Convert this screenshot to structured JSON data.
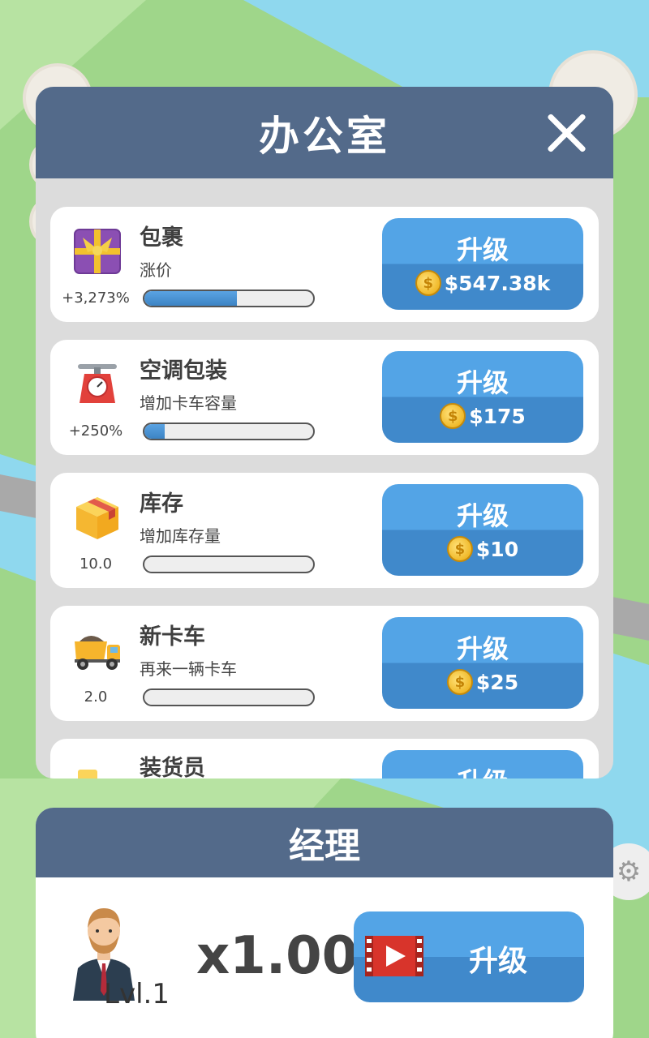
{
  "office": {
    "title": "办公室",
    "items": [
      {
        "name": "包裹",
        "desc": "涨价",
        "stat": "+3,273%",
        "progress": 0.55,
        "button_label": "升级",
        "price": "$547.38k",
        "icon": "gift-box-icon"
      },
      {
        "name": "空调包装",
        "desc": "增加卡车容量",
        "stat": "+250%",
        "progress": 0.12,
        "button_label": "升级",
        "price": "$175",
        "icon": "scale-icon"
      },
      {
        "name": "库存",
        "desc": "增加库存量",
        "stat": "10.0",
        "progress": 0.0,
        "button_label": "升级",
        "price": "$10",
        "icon": "crate-icon"
      },
      {
        "name": "新卡车",
        "desc": "再来一辆卡车",
        "stat": "2.0",
        "progress": 0.0,
        "button_label": "升级",
        "price": "$25",
        "icon": "dump-truck-icon"
      },
      {
        "name": "装货员",
        "button_label": "升级",
        "icon": "loader-icon"
      }
    ]
  },
  "manager": {
    "title": "经理",
    "level": "Lvl.1",
    "multiplier": "x1.00",
    "button_label": "升级",
    "icon": "video-ad-icon"
  },
  "coin_symbol": "$",
  "colors": {
    "header": "#536a8a",
    "button": "#4a96d8",
    "panel_bg": "#dcdcdc"
  }
}
